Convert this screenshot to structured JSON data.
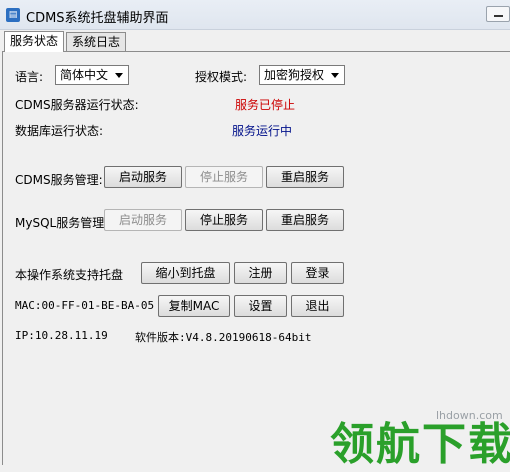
{
  "window": {
    "title": "CDMS系统托盘辅助界面",
    "icon": "app-icon"
  },
  "tabs": [
    {
      "label": "服务状态",
      "active": true
    },
    {
      "label": "系统日志",
      "active": false
    }
  ],
  "settings": {
    "language_label": "语言:",
    "language_value": "简体中文",
    "auth_label": "授权模式:",
    "auth_value": "加密狗授权"
  },
  "status": {
    "server_label": "CDMS服务器运行状态:",
    "server_value": "服务已停止",
    "db_label": "数据库运行状态:",
    "db_value": "服务运行中"
  },
  "cdms_service": {
    "label": "CDMS服务管理:",
    "start": "启动服务",
    "stop": "停止服务",
    "restart": "重启服务"
  },
  "mysql_service": {
    "label": "MySQL服务管理:",
    "start": "启动服务",
    "stop": "停止服务",
    "restart": "重启服务"
  },
  "tray": {
    "label": "本操作系统支持托盘",
    "minimize": "缩小到托盘",
    "register": "注册",
    "login": "登录"
  },
  "mac": {
    "text": "MAC:00-FF-01-BE-BA-05",
    "copy": "复制MAC",
    "settings": "设置",
    "exit": "退出"
  },
  "info": {
    "ip": "IP:10.28.11.19",
    "version": "软件版本:V4.8.20190618-64bit"
  },
  "watermark": {
    "text": "领航下载",
    "url": "lhdown.com"
  },
  "colors": {
    "stopped": "#cc0000",
    "running": "#00108a",
    "watermark": "#2aa02a"
  }
}
